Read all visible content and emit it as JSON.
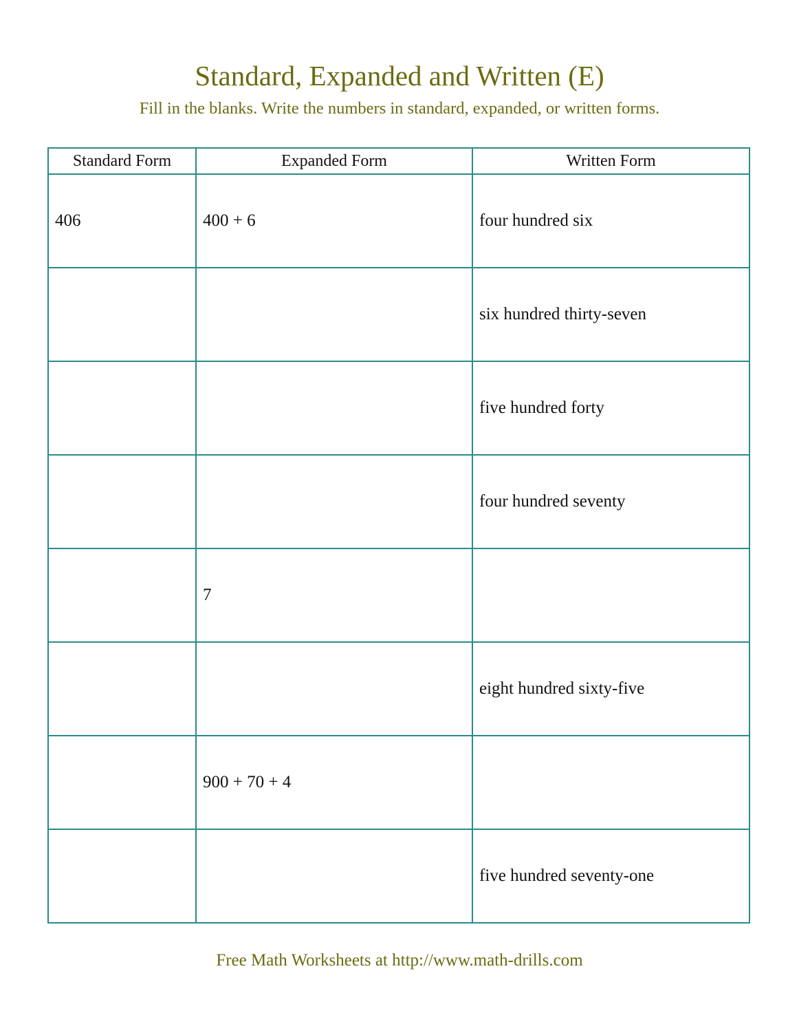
{
  "header": {
    "title": "Standard, Expanded and Written (E)",
    "instructions": "Fill in the blanks. Write the numbers in standard, expanded, or written forms."
  },
  "table": {
    "columns": [
      "Standard Form",
      "Expanded Form",
      "Written Form"
    ],
    "rows": [
      [
        "406",
        "400 + 6",
        "four hundred six"
      ],
      [
        "",
        "",
        "six hundred thirty-seven"
      ],
      [
        "",
        "",
        "five hundred forty"
      ],
      [
        "",
        "",
        "four hundred seventy"
      ],
      [
        "",
        "7",
        ""
      ],
      [
        "",
        "",
        "eight hundred sixty-five"
      ],
      [
        "",
        "900 + 70 + 4",
        ""
      ],
      [
        "",
        "",
        "five hundred seventy-one"
      ]
    ]
  },
  "footer": {
    "text": "Free Math Worksheets at http://www.math-drills.com"
  },
  "colors": {
    "heading": "#6b6b12",
    "table_border": "#2a8a8a"
  }
}
